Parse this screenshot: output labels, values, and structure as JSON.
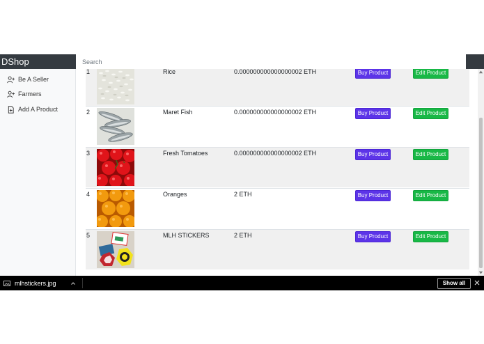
{
  "header": {
    "brand": "DShop",
    "search_placeholder": "Search"
  },
  "sidebar": {
    "items": [
      {
        "label": "Be A Seller",
        "icon": "user-plus-icon"
      },
      {
        "label": "Farmers",
        "icon": "user-plus-icon"
      },
      {
        "label": "Add A Product",
        "icon": "file-plus-icon"
      }
    ]
  },
  "products": [
    {
      "num": "1",
      "name": "Rice",
      "price": "0.000000000000000002 ETH",
      "buy_label": "Buy Product",
      "edit_label": "Edit Product"
    },
    {
      "num": "2",
      "name": "Maret Fish",
      "price": "0.000000000000000002 ETH",
      "buy_label": "Buy Product",
      "edit_label": "Edit Product"
    },
    {
      "num": "3",
      "name": "Fresh Tomatoes",
      "price": "0.000000000000000002 ETH",
      "buy_label": "Buy Product",
      "edit_label": "Edit Product"
    },
    {
      "num": "4",
      "name": "Oranges",
      "price": "2 ETH",
      "buy_label": "Buy Product",
      "edit_label": "Edit Product"
    },
    {
      "num": "5",
      "name": "MLH STICKERS",
      "price": "2 ETH",
      "buy_label": "Buy Product",
      "edit_label": "Edit Product"
    }
  ],
  "download_bar": {
    "file_name": "mlhstickers.jpg",
    "show_all_label": "Show all"
  },
  "colors": {
    "navbar": "#343a40",
    "buy_button": "#5c34e8",
    "edit_button": "#18b846",
    "row_alt": "#f0f0f0"
  }
}
